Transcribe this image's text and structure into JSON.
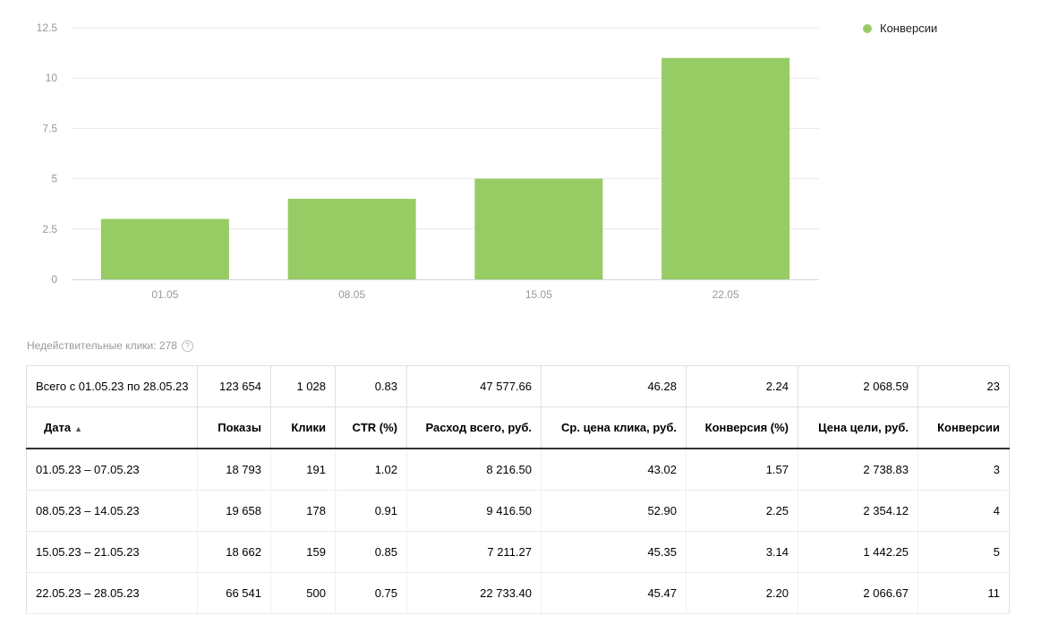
{
  "colors": {
    "bar": "#96cc63",
    "grid": "#e9e9e9",
    "axis": "#cfd8dc",
    "tick": "#999999"
  },
  "chart_data": {
    "type": "bar",
    "categories": [
      "01.05",
      "08.05",
      "15.05",
      "22.05"
    ],
    "series": [
      {
        "name": "Конверсии",
        "values": [
          3,
          4,
          5,
          11
        ]
      }
    ],
    "ylim": [
      0,
      12.5
    ],
    "yticks": [
      "0",
      "2.5",
      "5",
      "7.5",
      "10",
      "12.5"
    ],
    "grid": true,
    "legend_position": "top-right"
  },
  "legend": {
    "label": "Конверсии"
  },
  "invalid_clicks": {
    "label": "Недействительные клики: 278",
    "icon": "question-circle-icon"
  },
  "table": {
    "total": [
      "Всего с 01.05.23 по 28.05.23",
      "123 654",
      "1 028",
      "0.83",
      "47 577.66",
      "46.28",
      "2.24",
      "2 068.59",
      "23"
    ],
    "columns": [
      "Дата",
      "Показы",
      "Клики",
      "CTR (%)",
      "Расход всего, руб.",
      "Ср. цена клика, руб.",
      "Конверсия (%)",
      "Цена цели, руб.",
      "Конверсии"
    ],
    "sort_indicator": "▲",
    "rows": [
      [
        "01.05.23 – 07.05.23",
        "18 793",
        "191",
        "1.02",
        "8 216.50",
        "43.02",
        "1.57",
        "2 738.83",
        "3"
      ],
      [
        "08.05.23 – 14.05.23",
        "19 658",
        "178",
        "0.91",
        "9 416.50",
        "52.90",
        "2.25",
        "2 354.12",
        "4"
      ],
      [
        "15.05.23 – 21.05.23",
        "18 662",
        "159",
        "0.85",
        "7 211.27",
        "45.35",
        "3.14",
        "1 442.25",
        "5"
      ],
      [
        "22.05.23 – 28.05.23",
        "66 541",
        "500",
        "0.75",
        "22 733.40",
        "45.47",
        "2.20",
        "2 066.67",
        "11"
      ]
    ]
  }
}
